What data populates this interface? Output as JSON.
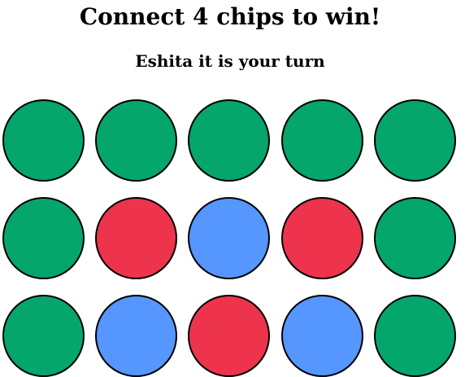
{
  "header": {
    "title": "Connect 4 chips to win!",
    "turn_message": "Eshita it is your turn"
  },
  "colors": {
    "empty": "#05a66b",
    "red": "#ee334d",
    "blue": "#5596ff",
    "outline": "#000000"
  },
  "board": {
    "rows": [
      [
        "empty",
        "empty",
        "empty",
        "empty",
        "empty"
      ],
      [
        "empty",
        "red",
        "blue",
        "red",
        "empty"
      ],
      [
        "empty",
        "blue",
        "red",
        "blue",
        "empty"
      ]
    ]
  }
}
